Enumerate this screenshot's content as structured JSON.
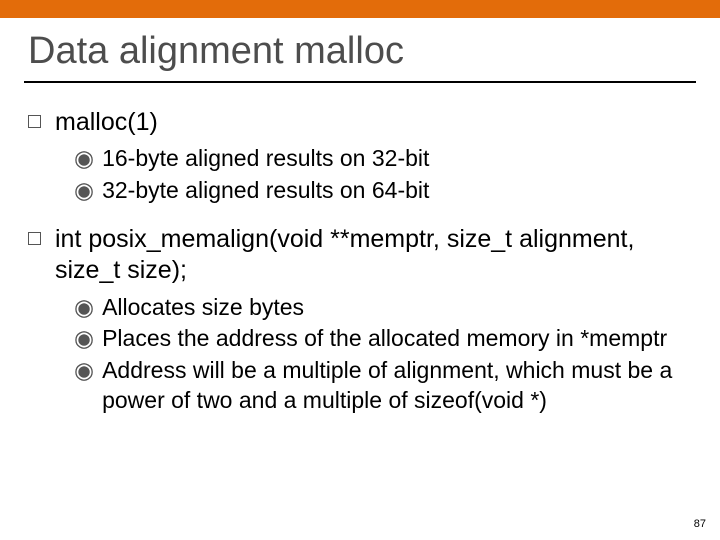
{
  "title": "Data alignment malloc",
  "items": [
    {
      "text": "malloc(1)",
      "sub": [
        "16-byte aligned results on 32-bit",
        "32-byte aligned results on 64-bit"
      ]
    },
    {
      "text": " int posix_memalign(void **memptr, size_t alignment, size_t size);",
      "sub": [
        "Allocates size bytes",
        "Places the address of the allocated memory in *memptr",
        "Address will  be a multiple of alignment, which must be a power of two and a multiple of sizeof(void *)"
      ]
    }
  ],
  "page_number": "87"
}
